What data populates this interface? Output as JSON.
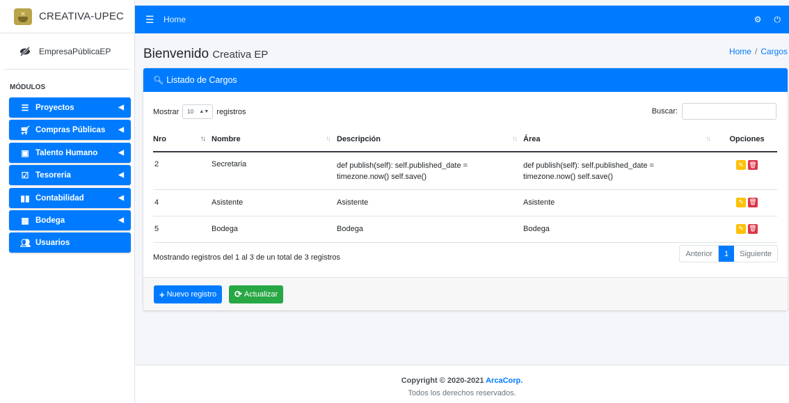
{
  "brand": {
    "name": "CREATIVA-UPEC"
  },
  "user": {
    "name": "EmpresaPúblicaEP"
  },
  "sidebar": {
    "header": "MÓDULOS",
    "items": [
      {
        "label": "Proyectos",
        "icon": "list-icon",
        "expandable": true
      },
      {
        "label": "Compras Públicas",
        "icon": "cart-icon",
        "expandable": true
      },
      {
        "label": "Talento Humano",
        "icon": "id-card-icon",
        "expandable": true
      },
      {
        "label": "Tesoreria",
        "icon": "calendar-check-icon",
        "expandable": true
      },
      {
        "label": "Contabilidad",
        "icon": "book-icon",
        "expandable": true
      },
      {
        "label": "Bodega",
        "icon": "boxes-icon",
        "expandable": true
      },
      {
        "label": "Usuarios",
        "icon": "users-icon",
        "expandable": false
      }
    ]
  },
  "topbar": {
    "home": "Home"
  },
  "page": {
    "title": "Bienvenido",
    "subtitle": "Creativa EP"
  },
  "breadcrumb": {
    "home": "Home",
    "sep": "/",
    "current": "Cargos"
  },
  "card": {
    "title": "Listado de Cargos",
    "length": {
      "prefix": "Mostrar",
      "value": "10",
      "suffix": "registros"
    },
    "search_label": "Buscar:",
    "columns": [
      "Nro",
      "Nombre",
      "Descripción",
      "Área",
      "Opciones"
    ],
    "rows": [
      {
        "nro": "2",
        "nombre": "Secretaria",
        "descripcion": "def publish(self): self.published_date = timezone.now() self.save()",
        "area": "def publish(self): self.published_date = timezone.now() self.save()"
      },
      {
        "nro": "4",
        "nombre": "Asistente",
        "descripcion": "Asistente",
        "area": "Asistente"
      },
      {
        "nro": "5",
        "nombre": "Bodega",
        "descripcion": "Bodega",
        "area": "Bodega"
      }
    ],
    "info": "Mostrando registros del 1 al 3 de un total de 3 registros",
    "pager": {
      "prev": "Anterior",
      "current": "1",
      "next": "Siguiente"
    },
    "buttons": {
      "new": "Nuevo registro",
      "refresh": "Actualizar"
    }
  },
  "footer": {
    "copyright": "Copyright © 2020-2021",
    "company": "ArcaCorp.",
    "rights": "Todos los derechos reservados."
  },
  "colors": {
    "primary": "#007bff",
    "success": "#28a745",
    "warning": "#ffc107",
    "danger": "#dc3545"
  }
}
